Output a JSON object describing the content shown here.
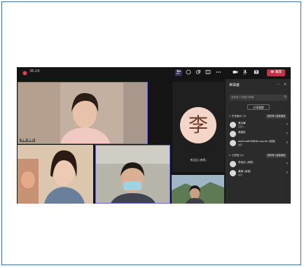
{
  "meeting": {
    "timer": "36:24",
    "leave_label": "離開"
  },
  "icons": {
    "record": "record-dot-icon",
    "people": "people-icon",
    "chat": "chat-icon",
    "reactions": "reactions-icon",
    "rooms": "breakout-rooms-icon",
    "more": "more-icon",
    "camera": "camera-icon",
    "mic": "microphone-icon",
    "share": "share-tray-icon",
    "phone": "phone-hangup-icon"
  },
  "video": {
    "tile1_name": "李美 (來賓)",
    "tile4_name": "",
    "avatar_char": "李",
    "avatar_name": "李品佳 (來賓)"
  },
  "panel": {
    "title": "參與者",
    "search_placeholder": "邀請某人或撥打號碼",
    "invite_label": "分享邀請",
    "section_in_meeting": "∨ 在會議中 (3)",
    "mute_all": "將所有人設為靜音",
    "participants": [
      {
        "name": "張玉華",
        "sub": "召集人"
      },
      {
        "name": "張嘉宏",
        "sub": ""
      },
      {
        "name": "wenhua608@tkt.org.tw (來賓)",
        "sub": "來賓"
      }
    ],
    "section_others": "∨ 已受邀 (2)",
    "others_action": "將所有人設為靜音",
    "others": [
      {
        "name": "李品佳 (來賓)",
        "sub": ""
      },
      {
        "name": "黃琳 (來賓)",
        "sub": "來賓"
      }
    ]
  }
}
